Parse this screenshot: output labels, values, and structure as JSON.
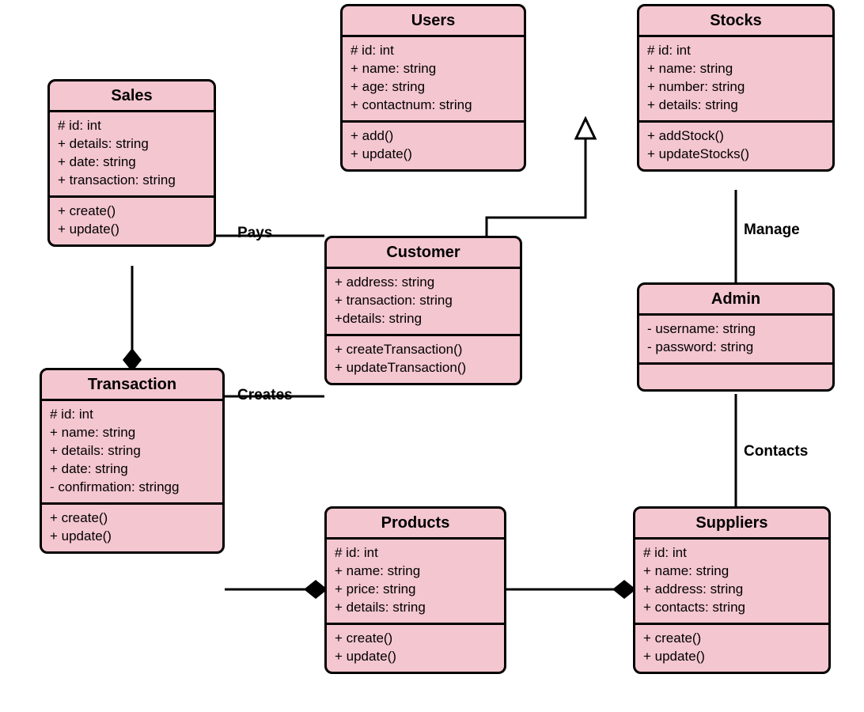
{
  "classes": {
    "users": {
      "title": "Users",
      "attrs": [
        "# id: int",
        "+ name: string",
        "+ age: string",
        "+ contactnum: string"
      ],
      "ops": [
        "+ add()",
        "+ update()"
      ]
    },
    "stocks": {
      "title": "Stocks",
      "attrs": [
        "# id: int",
        "+ name: string",
        "+ number: string",
        "+ details: string"
      ],
      "ops": [
        "+ addStock()",
        "+ updateStocks()"
      ]
    },
    "sales": {
      "title": "Sales",
      "attrs": [
        "# id: int",
        "+ details: string",
        "+ date: string",
        "+ transaction: string"
      ],
      "ops": [
        "+ create()",
        "+ update()"
      ]
    },
    "customer": {
      "title": "Customer",
      "attrs": [
        "+ address: string",
        "+ transaction: string",
        "+details: string"
      ],
      "ops": [
        "+ createTransaction()",
        "+ updateTransaction()"
      ]
    },
    "admin": {
      "title": "Admin",
      "attrs": [
        "- username: string",
        "- password: string"
      ],
      "ops": []
    },
    "transaction": {
      "title": "Transaction",
      "attrs": [
        "# id: int",
        "+ name: string",
        "+ details: string",
        "+ date: string",
        "- confirmation: stringg"
      ],
      "ops": [
        "+ create()",
        "+ update()"
      ]
    },
    "products": {
      "title": "Products",
      "attrs": [
        "# id: int",
        "+ name: string",
        "+ price: string",
        "+ details: string"
      ],
      "ops": [
        "+ create()",
        "+ update()"
      ]
    },
    "suppliers": {
      "title": "Suppliers",
      "attrs": [
        "# id: int",
        "+ name: string",
        "+ address: string",
        "+ contacts: string"
      ],
      "ops": [
        "+ create()",
        "+ update()"
      ]
    }
  },
  "labels": {
    "pays": "Pays",
    "manage": "Manage",
    "creates": "Creates",
    "contacts": "Contacts"
  }
}
